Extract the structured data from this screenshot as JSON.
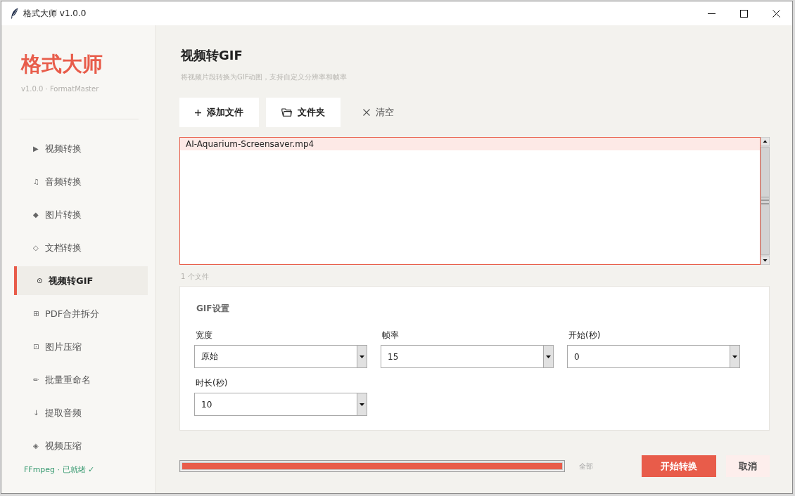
{
  "window": {
    "title": "格式大师 v1.0.0"
  },
  "sidebar": {
    "logo": "格式大师",
    "version": "v1.0.0 · FormatMaster",
    "items": [
      {
        "icon": "▶",
        "label": "视频转换",
        "selected": false
      },
      {
        "icon": "♫",
        "label": "音频转换",
        "selected": false
      },
      {
        "icon": "◆",
        "label": "图片转换",
        "selected": false
      },
      {
        "icon": "◇",
        "label": "文档转换",
        "selected": false
      },
      {
        "icon": "⊙",
        "label": "视频转GIF",
        "selected": true
      },
      {
        "icon": "⊞",
        "label": "PDF合并拆分",
        "selected": false
      },
      {
        "icon": "⊡",
        "label": "图片压缩",
        "selected": false
      },
      {
        "icon": "✏",
        "label": "批量重命名",
        "selected": false
      },
      {
        "icon": "↓",
        "label": "提取音频",
        "selected": false
      },
      {
        "icon": "◈",
        "label": "视频压缩",
        "selected": false
      }
    ],
    "status": "FFmpeg · 已就绪 ✓"
  },
  "page": {
    "title": "视频转GIF",
    "subtitle": "将视频片段转换为GIF动图，支持自定义分辨率和帧率"
  },
  "toolbar": [
    {
      "kind": "add",
      "label": "添加文件"
    },
    {
      "kind": "folder",
      "label": "文件夹"
    },
    {
      "kind": "clear",
      "label": "清空"
    }
  ],
  "file_list": {
    "files": [
      {
        "name": "AI-Aquarium-Screensaver.mp4",
        "selected": true
      }
    ],
    "count": "1 个文件"
  },
  "settings": {
    "title": "GIF设置",
    "fields": [
      {
        "label": "宽度",
        "value": "原始"
      },
      {
        "label": "帧率",
        "value": "15"
      },
      {
        "label": "开始(秒)",
        "value": "0"
      },
      {
        "label": "时长(秒)",
        "value": "10"
      }
    ]
  },
  "footer": {
    "progress": {
      "level": 1
    },
    "status": "全部",
    "buttons": [
      {
        "kind": "primary",
        "label": "开始转换"
      },
      {
        "kind": "secondary",
        "label": "取消"
      }
    ]
  }
}
